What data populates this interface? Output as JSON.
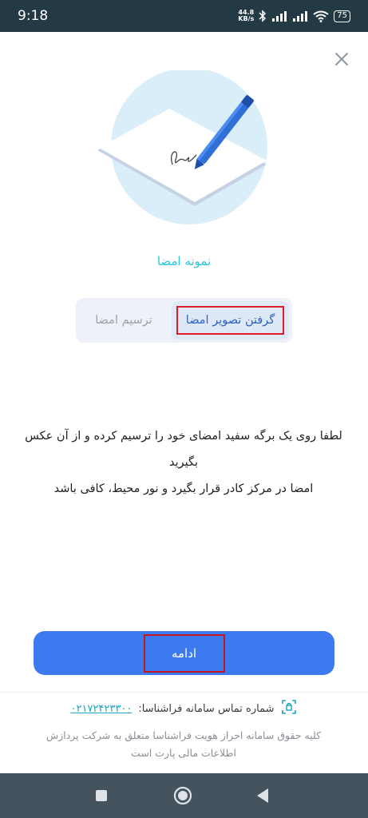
{
  "status_bar": {
    "time": "9:18",
    "net_speed_value": "44.8",
    "net_speed_unit": "KB/s",
    "battery": "75",
    "icons": [
      "bluetooth-icon",
      "signal-icon",
      "signal-icon",
      "wifi-icon",
      "battery-icon"
    ]
  },
  "header": {
    "close_icon": "close-icon"
  },
  "hero": {
    "icon": "signature-paper-pen-illustration"
  },
  "page_title": "نمونه امضا",
  "tabs": [
    {
      "label": "گرفتن تصویر امضا",
      "active": true
    },
    {
      "label": "ترسیم امضا",
      "active": false
    }
  ],
  "instructions": {
    "line1": "لطفا روی یک برگه سفید امضای خود را ترسیم کرده و از آن عکس",
    "line2": "بگیرید",
    "line3": "امضا در مرکز کادر قرار بگیرد و نور محیط، کافی باشد"
  },
  "cta": {
    "label": "ادامه"
  },
  "footer": {
    "contact_label": "شماره تماس سامانه فراشناسا:",
    "phone": "۰۲۱۷۲۴۲۳۳۰۰",
    "copyright_line1": "کلیه حقوق سامانه احراز هویت فراشناسا متعلق به شرکت پردازش",
    "copyright_line2": "اطلاعات مالی پارت است"
  },
  "nav_bar": {
    "buttons": [
      "square-icon",
      "circle-icon",
      "back-triangle-icon"
    ]
  },
  "colors": {
    "accent": "#3d7af0",
    "title_cyan": "#2ec4de",
    "status_bar": "#233944",
    "nav_bar": "#44535e",
    "highlight_red": "#e01b24"
  }
}
